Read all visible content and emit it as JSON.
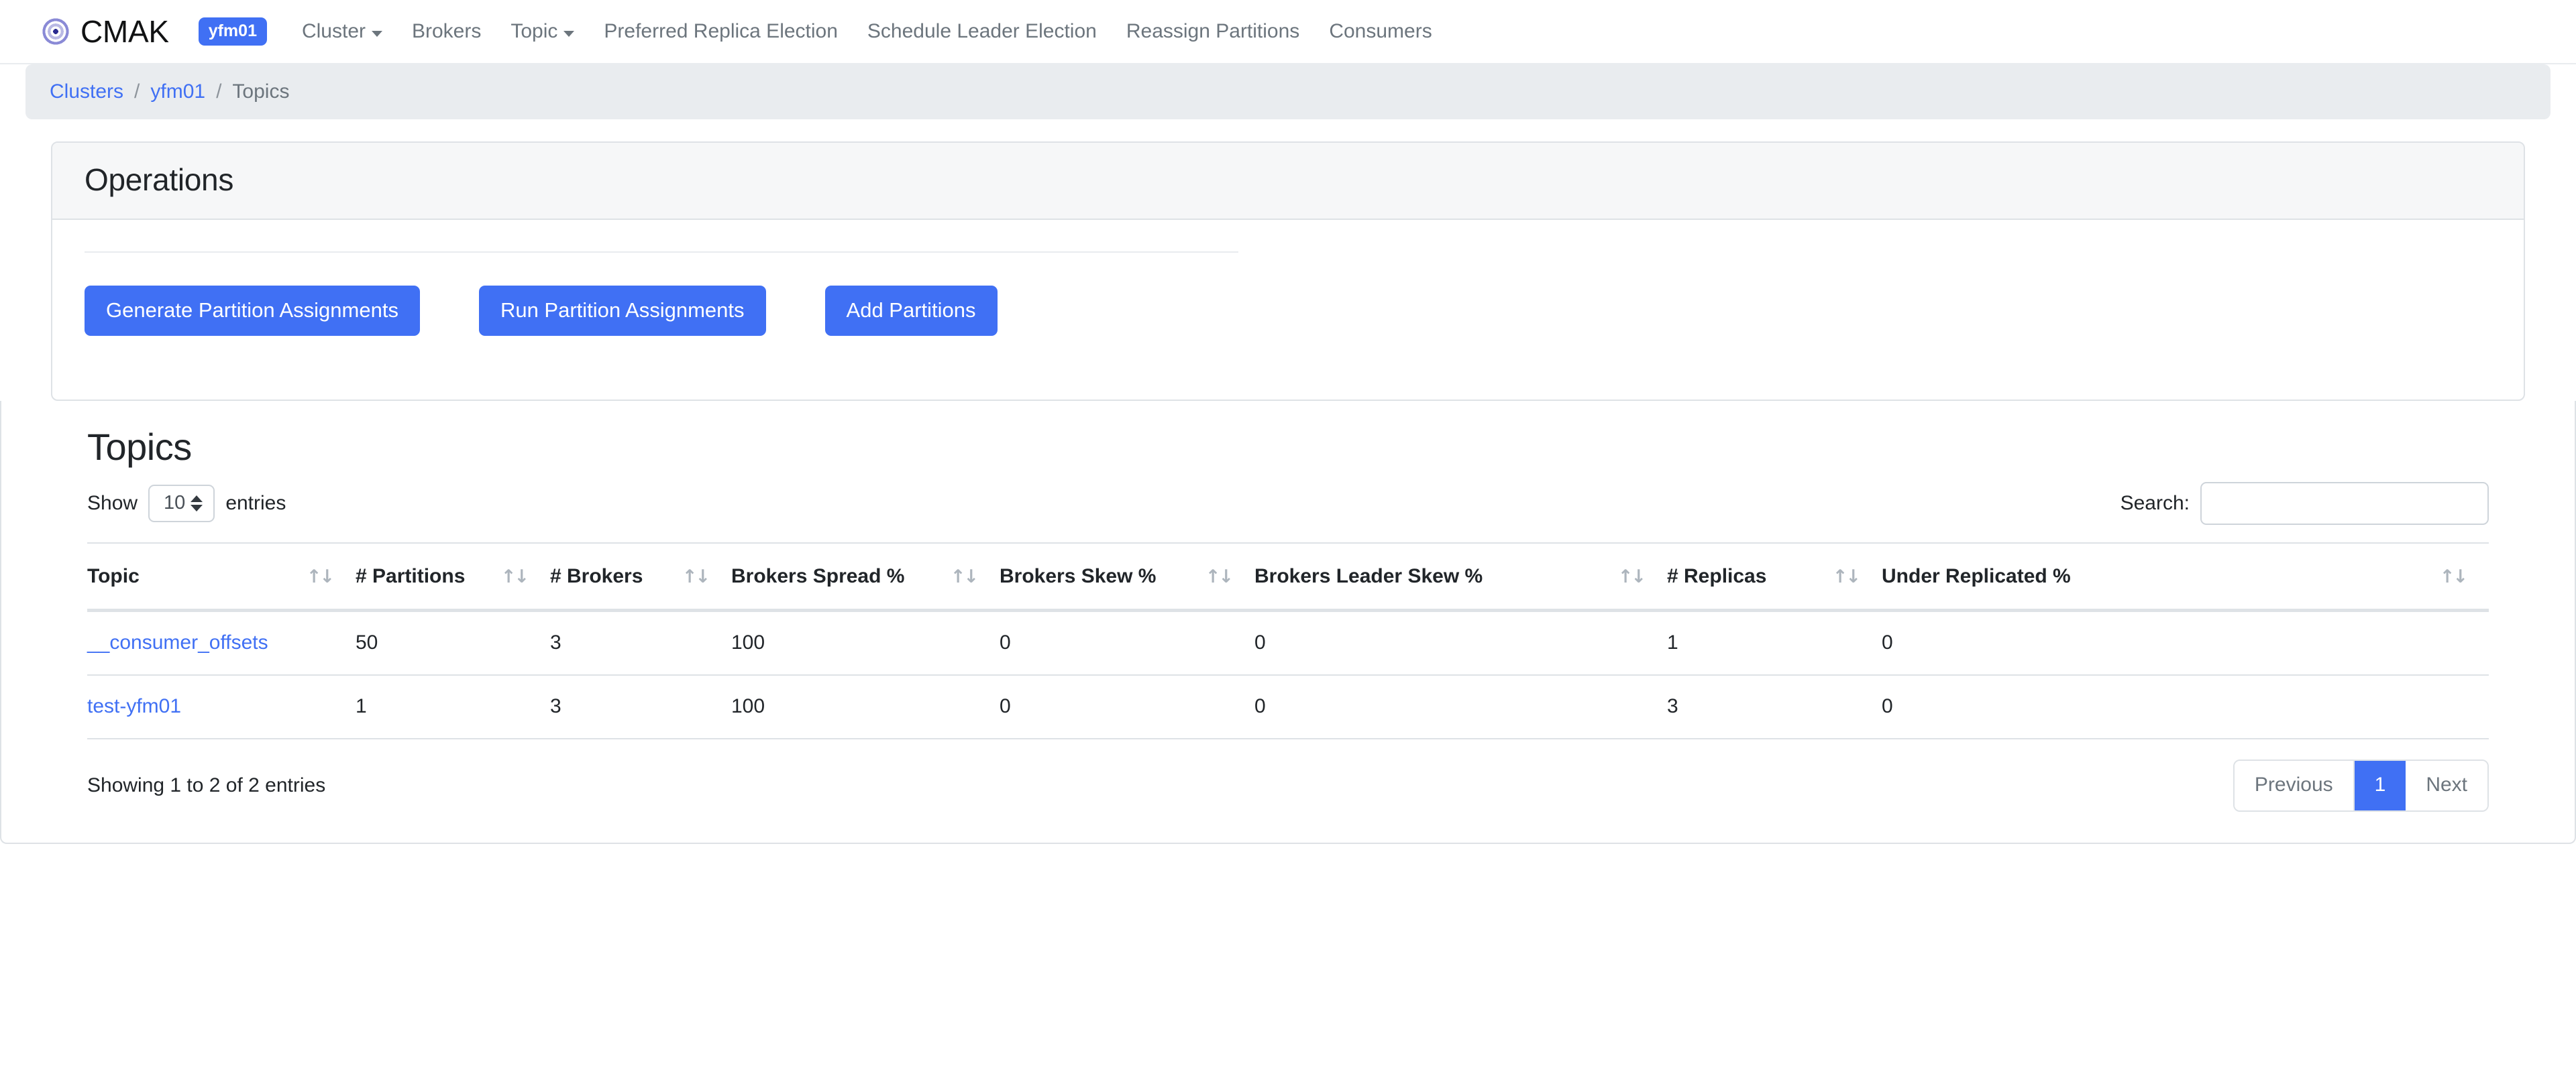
{
  "navbar": {
    "brand": "CMAK",
    "logo_icon": "cmak-radial-logo-icon",
    "cluster_badge": "yfm01",
    "links": [
      {
        "label": "Cluster",
        "has_caret": true
      },
      {
        "label": "Brokers",
        "has_caret": false
      },
      {
        "label": "Topic",
        "has_caret": true
      },
      {
        "label": "Preferred Replica Election",
        "has_caret": false
      },
      {
        "label": "Schedule Leader Election",
        "has_caret": false
      },
      {
        "label": "Reassign Partitions",
        "has_caret": false
      },
      {
        "label": "Consumers",
        "has_caret": false
      }
    ]
  },
  "breadcrumb": {
    "items": [
      {
        "label": "Clusters",
        "active": false
      },
      {
        "label": "yfm01",
        "active": false
      },
      {
        "label": "Topics",
        "active": true
      }
    ],
    "separator": "/"
  },
  "operations": {
    "title": "Operations",
    "buttons": [
      {
        "label": "Generate Partition Assignments"
      },
      {
        "label": "Run Partition Assignments"
      },
      {
        "label": "Add Partitions"
      }
    ]
  },
  "topics": {
    "title": "Topics",
    "length_label_before": "Show",
    "length_label_after": "entries",
    "length_value": "10",
    "search_label": "Search:",
    "search_value": "",
    "search_placeholder": "",
    "sort_icon": "↑↓",
    "columns": [
      "Topic",
      "# Partitions",
      "# Brokers",
      "Brokers Spread %",
      "Brokers Skew %",
      "Brokers Leader Skew %",
      "# Replicas",
      "Under Replicated %"
    ],
    "rows": [
      {
        "topic": "__consumer_offsets",
        "partitions": "50",
        "brokers": "3",
        "brokers_spread": "100",
        "brokers_skew": "0",
        "brokers_leader_skew": "0",
        "replicas": "1",
        "under_replicated": "0"
      },
      {
        "topic": "test-yfm01",
        "partitions": "1",
        "brokers": "3",
        "brokers_spread": "100",
        "brokers_skew": "0",
        "brokers_leader_skew": "0",
        "replicas": "3",
        "under_replicated": "0"
      }
    ],
    "info": "Showing 1 to 2 of 2 entries",
    "pagination": {
      "previous": "Previous",
      "pages": [
        "1"
      ],
      "next": "Next",
      "current": "1"
    }
  },
  "colors": {
    "primary": "#4070f4",
    "link": "#4070f4",
    "muted": "#6c757d",
    "border": "#dee2e6",
    "breadcrumb_bg": "#e9ecef",
    "card_header_bg": "#f6f7f8"
  }
}
